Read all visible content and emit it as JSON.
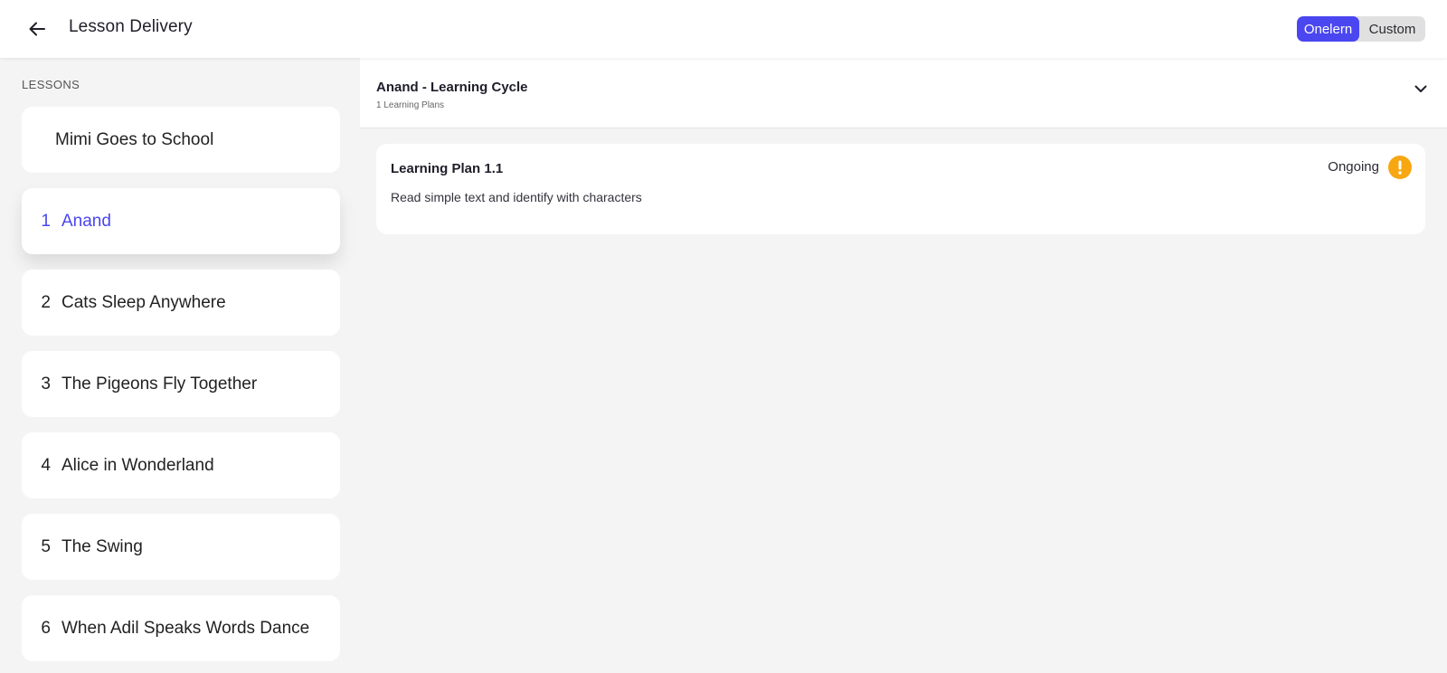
{
  "header": {
    "title": "Lesson Delivery",
    "back_icon": "arrow-left-icon",
    "toggle": {
      "active_label": "Onelern",
      "inactive_label": "Custom"
    }
  },
  "colors": {
    "accent": "#4a46f0",
    "warning": "#f6a711",
    "background": "#f4f4f4"
  },
  "sidebar": {
    "heading": "LESSONS",
    "lessons": [
      {
        "num": "",
        "label": "Mimi Goes to School"
      },
      {
        "num": "1",
        "label": "Anand",
        "active": true
      },
      {
        "num": "2",
        "label": "Cats Sleep Anywhere"
      },
      {
        "num": "3",
        "label": "The Pigeons Fly Together"
      },
      {
        "num": "4",
        "label": "Alice in Wonderland"
      },
      {
        "num": "5",
        "label": "The Swing"
      },
      {
        "num": "6",
        "label": "When Adil Speaks Words Dance"
      }
    ]
  },
  "main": {
    "cycle": {
      "title": "Anand - Learning Cycle",
      "subtitle": "1 Learning Plans",
      "chevron_icon": "chevron-down-icon"
    },
    "plans": [
      {
        "title": "Learning Plan 1.1",
        "description": "Read simple text and identify with characters",
        "status": "Ongoing",
        "status_icon": "exclamation-circle-icon"
      }
    ]
  }
}
